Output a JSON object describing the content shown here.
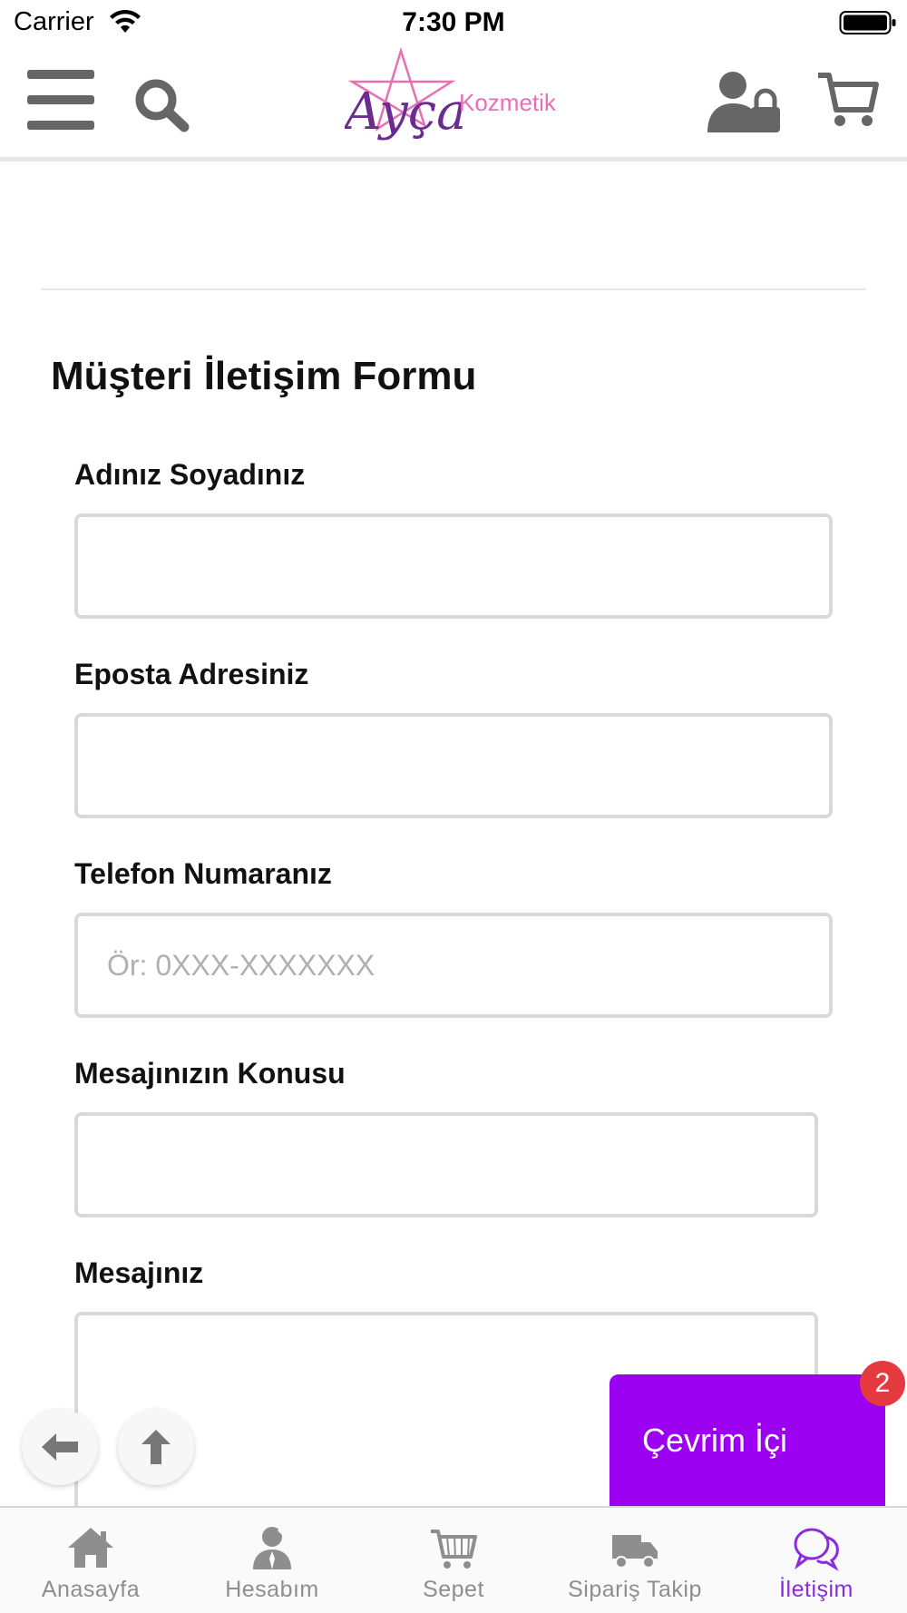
{
  "status_bar": {
    "carrier": "Carrier",
    "time": "7:30 PM"
  },
  "header": {
    "logo": {
      "script": "Ayça",
      "word": "Kozmetik"
    },
    "icons": [
      "menu-icon",
      "search-icon",
      "user-lock-icon",
      "cart-icon"
    ]
  },
  "form": {
    "title": "Müşteri İletişim Formu",
    "fields": [
      {
        "label": "Adınız Soyadınız",
        "value": "",
        "placeholder": ""
      },
      {
        "label": "Eposta Adresiniz",
        "value": "",
        "placeholder": ""
      },
      {
        "label": "Telefon Numaranız",
        "value": "",
        "placeholder": "Ör: 0XXX-XXXXXXX"
      },
      {
        "label": "Mesajınızın Konusu",
        "value": "",
        "placeholder": ""
      },
      {
        "label": "Mesajınız",
        "value": "",
        "placeholder": ""
      }
    ]
  },
  "floating": {
    "back_icon": "arrow-left-icon",
    "up_icon": "arrow-up-icon"
  },
  "chat": {
    "label": "Çevrim İçi",
    "badge_count": "2",
    "color": "#9b00f0",
    "badge_color": "#e53a40"
  },
  "tabs": [
    {
      "label": "Anasayfa",
      "icon": "home-icon",
      "active": false
    },
    {
      "label": "Hesabım",
      "icon": "account-icon",
      "active": false
    },
    {
      "label": "Sepet",
      "icon": "cart-icon",
      "active": false
    },
    {
      "label": "Sipariş Takip",
      "icon": "truck-icon",
      "active": false
    },
    {
      "label": "İletişim",
      "icon": "chat-bubbles-icon",
      "active": true
    }
  ],
  "colors": {
    "accent": "#8a2be2",
    "icon_gray": "#666666",
    "tab_gray": "#8e8e8e",
    "logo_purple": "#6a2c91",
    "logo_pink": "#e86fb3"
  }
}
